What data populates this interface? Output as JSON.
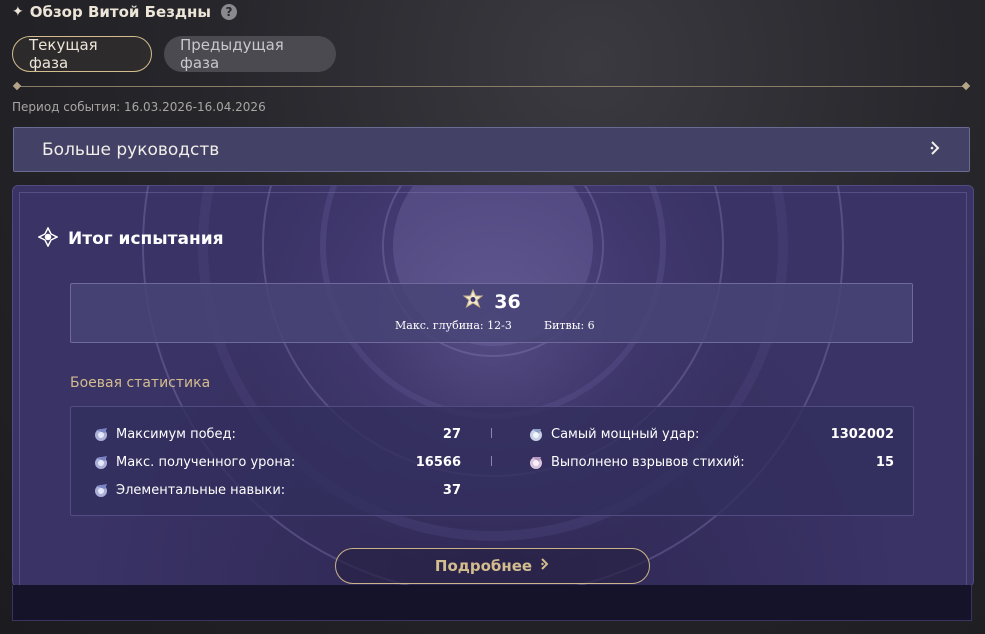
{
  "header": {
    "spark_icon": "sparkle-icon",
    "title": "Обзор Витой Бездны",
    "help_icon": "question-icon"
  },
  "tabs": [
    {
      "label": "Текущая фаза",
      "active": true
    },
    {
      "label": "Предыдущая фаза",
      "active": false
    }
  ],
  "period": "Период события: 16.03.2026-16.04.2026",
  "guides": {
    "label": "Больше руководств",
    "arrow_icon": "chevron-right-icon"
  },
  "summary": {
    "title": "Итог испытания",
    "title_icon": "abyss-emblem-icon",
    "stars": "36",
    "star_icon": "abyss-star-icon",
    "max_depth": "Макс. глубина: 12-3",
    "battles": "Битвы: 6"
  },
  "stats": {
    "title": "Боевая статистика",
    "items": [
      {
        "label": "Максимум побед:",
        "value": "27"
      },
      {
        "label": "Макс. полученного урона:",
        "value": "16566"
      },
      {
        "label": "Элементальные навыки:",
        "value": "37"
      },
      {
        "label": "Самый мощный удар:",
        "value": "1302002"
      },
      {
        "label": "Выполнено взрывов стихий:",
        "value": "15"
      }
    ]
  },
  "details_button": {
    "label": "Подробнее",
    "arrow_icon": "chevron-right-icon"
  },
  "colors": {
    "accent_gold": "#d3bc8e",
    "panel_purple": "#3d366a",
    "guides_bg": "#434166"
  }
}
